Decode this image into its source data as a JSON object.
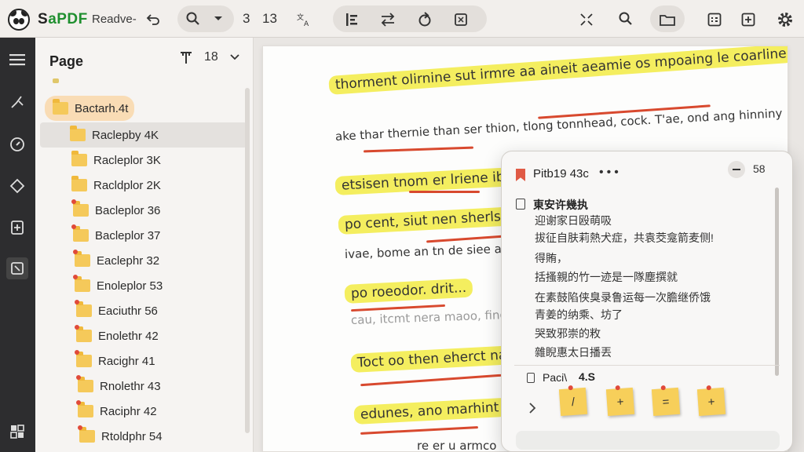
{
  "toolbar": {
    "app_name_prefix": "S",
    "app_name_rest": "aPDF",
    "doc_name": "Readve-",
    "current_page": "3",
    "total_pages": "13"
  },
  "panel": {
    "title": "Page",
    "count": "18",
    "items": [
      {
        "label": "Bactarh.4t"
      },
      {
        "label": "Raclepby 4K"
      },
      {
        "label": "Racleplor 3K"
      },
      {
        "label": "Racldplor 2K"
      },
      {
        "label": "Bacleplor 36"
      },
      {
        "label": "Bacleplor 37"
      },
      {
        "label": "Eaclephr 32"
      },
      {
        "label": "Enoleplor 53"
      },
      {
        "label": "Eaciuthr 56"
      },
      {
        "label": "Enolethr 42"
      },
      {
        "label": "Racighr 41"
      },
      {
        "label": "Rnolethr 43"
      },
      {
        "label": "Raciphr 42"
      },
      {
        "label": "Rtoldphr 54"
      }
    ]
  },
  "document": {
    "lines": [
      "thorment olirnine sut irmre aa aineit aeamie os mpoaing le coarline",
      "ake thar thernie than ser thion, tlong tonnhead, cock. T'ae, ond ang hinniny",
      "etsisen tnom er lriene ibid op",
      "po cent, siut nen sherls, ol",
      "ivae, bome an tn de siee arr",
      "po roeodor. drit...",
      "cau, itcmt nera maoo, fingo",
      "Toct oo then eherct naphr",
      "edunes, ano marhint does",
      "re er u armco"
    ]
  },
  "popup": {
    "title": "Pitb19 43c",
    "side": "58",
    "note_title": "東安许幾执",
    "note_lines": [
      "迎谢家日殴萌吸",
      "拔征自肤莉熱犬症，共袁茭龛箭麦侧!",
      "得賄，",
      "括搔親的竹一迹是一隊塵撰就",
      "在素鼓陷侠臭录鲁运每一次膽继侨饿",
      "青姜的纳乘、坊了",
      "哭致邪崇的敉",
      "雜睨惠太日播丟"
    ],
    "page_label": "Paci\\",
    "page_value": "4.S",
    "stickies": [
      "/",
      "+",
      "=",
      "+"
    ]
  }
}
